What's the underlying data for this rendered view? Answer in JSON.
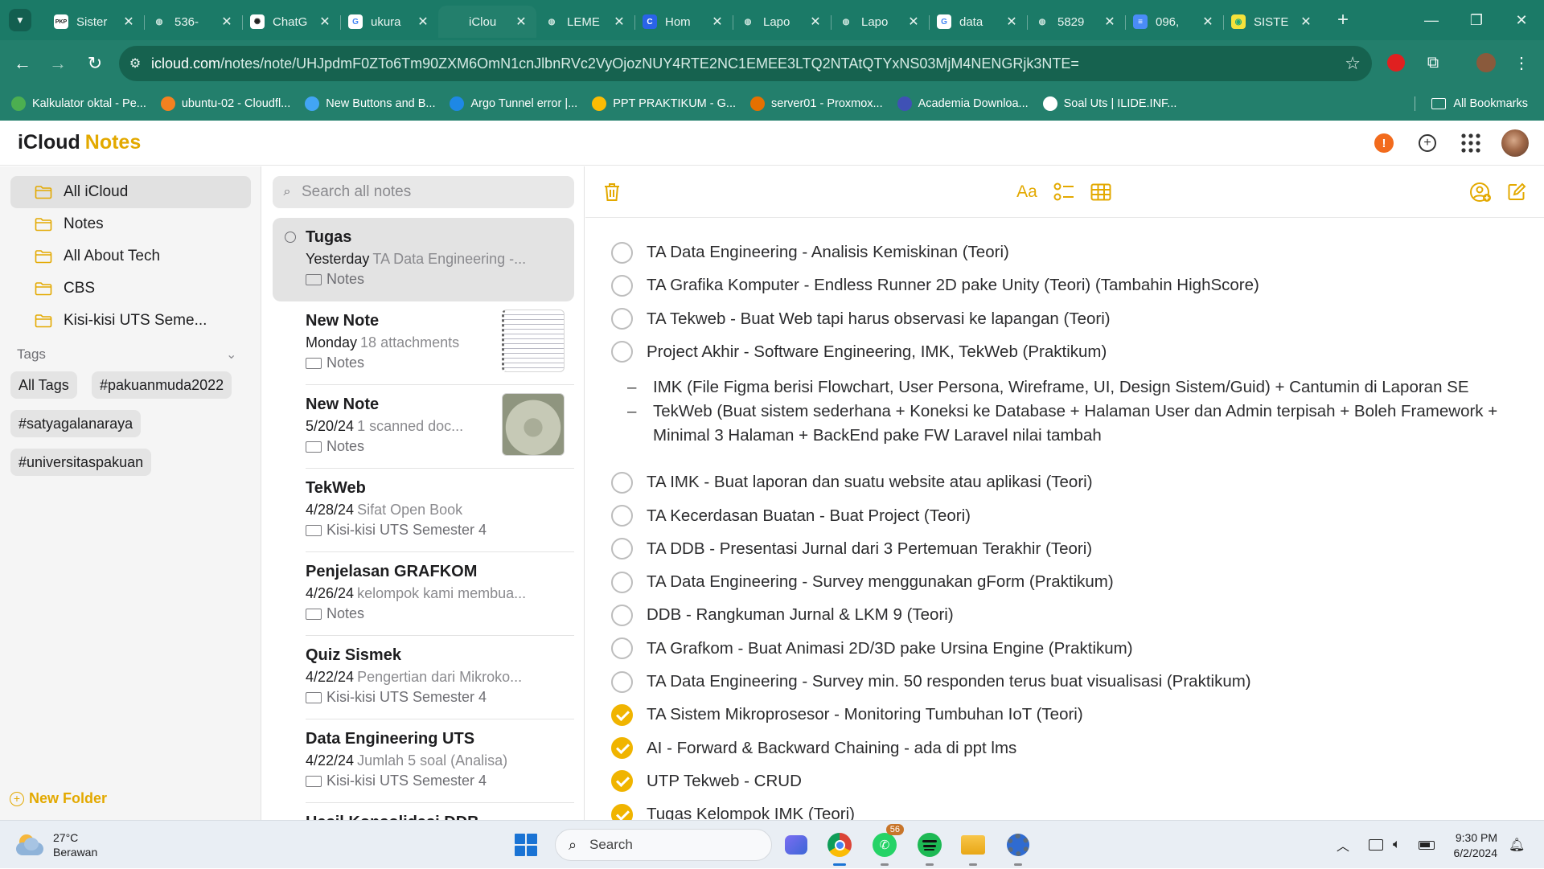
{
  "browser": {
    "tabs": [
      {
        "title": "Sister",
        "icon": "pkp-icon",
        "active": false
      },
      {
        "title": "536-",
        "icon": "globe-icon",
        "active": false
      },
      {
        "title": "ChatG",
        "icon": "openai-icon",
        "active": false
      },
      {
        "title": "ukura",
        "icon": "google-icon",
        "active": false
      },
      {
        "title": "iClou",
        "icon": "apple-icon",
        "active": true
      },
      {
        "title": "LEME",
        "icon": "globe-icon",
        "active": false
      },
      {
        "title": "Hom",
        "icon": "canva-icon",
        "active": false
      },
      {
        "title": "Lapo",
        "icon": "globe-icon",
        "active": false
      },
      {
        "title": "Lapo",
        "icon": "globe-icon",
        "active": false
      },
      {
        "title": "data",
        "icon": "google-icon",
        "active": false
      },
      {
        "title": "5829",
        "icon": "globe-icon",
        "active": false
      },
      {
        "title": "096,",
        "icon": "docs-icon",
        "active": false
      },
      {
        "title": "SISTE",
        "icon": "siste-icon",
        "active": false
      }
    ],
    "url_host": "icloud.com",
    "url_path": "/notes/note/UHJpdmF0ZTo6Tm90ZXM6OmN1cnJlbnRVc2VyOjozNUY4RTE2NC1EMEE3LTQ2NTAtQTYxNS03MjM4NENGRjk3NTE=",
    "bookmarks": [
      {
        "label": "Kalkulator oktal - Pe...",
        "icon": "gear-icon",
        "color": "#4caf50"
      },
      {
        "label": "ubuntu-02 - Cloudfl...",
        "icon": "cloudflare-icon",
        "color": "#f48120"
      },
      {
        "label": "New Buttons and B...",
        "icon": "feather-icon",
        "color": "#42a5f5"
      },
      {
        "label": "Argo Tunnel error |...",
        "icon": "argo-icon",
        "color": "#1e88e5"
      },
      {
        "label": "PPT PRAKTIKUM - G...",
        "icon": "drive-icon",
        "color": "#fbbc04"
      },
      {
        "label": "server01 - Proxmox...",
        "icon": "proxmox-icon",
        "color": "#e57000"
      },
      {
        "label": "Academia Downloa...",
        "icon": "academia-icon",
        "color": "#3f51b5"
      },
      {
        "label": "Soal Uts | ILIDE.INF...",
        "icon": "globe-icon",
        "color": "#ffffff"
      }
    ],
    "all_bookmarks_label": "All Bookmarks"
  },
  "app": {
    "brand_icloud": "iCloud",
    "brand_notes": "Notes",
    "accent": "#e3a900"
  },
  "sidebar": {
    "folders": [
      {
        "label": "All iCloud",
        "active": true
      },
      {
        "label": "Notes",
        "active": false
      },
      {
        "label": "All About Tech",
        "active": false
      },
      {
        "label": "CBS",
        "active": false
      },
      {
        "label": "Kisi-kisi UTS Seme...",
        "active": false
      }
    ],
    "tags_label": "Tags",
    "tags": [
      "All Tags",
      "#pakuanmuda2022",
      "#satyagalanaraya",
      "#universitaspakuan"
    ],
    "new_folder_label": "New Folder"
  },
  "notelist": {
    "search_placeholder": "Search all notes",
    "notes": [
      {
        "title": "Tugas",
        "date": "Yesterday",
        "snippet": "TA Data Engineering -...",
        "folder": "Notes",
        "selected": true,
        "shared": true,
        "thumb": "none"
      },
      {
        "title": "New Note",
        "date": "Monday",
        "snippet": "18 attachments",
        "folder": "Notes",
        "selected": false,
        "shared": false,
        "thumb": "handwriting"
      },
      {
        "title": "New Note",
        "date": "5/20/24",
        "snippet": "1 scanned doc...",
        "folder": "Notes",
        "selected": false,
        "shared": false,
        "thumb": "certificate"
      },
      {
        "title": "TekWeb",
        "date": "4/28/24",
        "snippet": "Sifat Open Book",
        "folder": "Kisi-kisi UTS Semester 4",
        "selected": false,
        "shared": false,
        "thumb": "none"
      },
      {
        "title": "Penjelasan GRAFKOM",
        "date": "4/26/24",
        "snippet": "kelompok kami membua...",
        "folder": "Notes",
        "selected": false,
        "shared": false,
        "thumb": "none"
      },
      {
        "title": "Quiz Sismek",
        "date": "4/22/24",
        "snippet": "Pengertian dari Mikroko...",
        "folder": "Kisi-kisi UTS Semester 4",
        "selected": false,
        "shared": false,
        "thumb": "none"
      },
      {
        "title": "Data Engineering UTS",
        "date": "4/22/24",
        "snippet": "Jumlah 5 soal (Analisa)",
        "folder": "Kisi-kisi UTS Semester 4",
        "selected": false,
        "shared": false,
        "thumb": "none"
      },
      {
        "title": "Hasil Konsolidasi DDB, ...",
        "date": "",
        "snippet": "",
        "folder": "",
        "selected": false,
        "shared": false,
        "thumb": "none"
      }
    ]
  },
  "editor": {
    "format_label": "Aa",
    "tasks_before": [
      {
        "text": "TA Data Engineering - Analisis Kemiskinan (Teori)",
        "done": false
      },
      {
        "text": "TA Grafika Komputer - Endless Runner 2D pake Unity (Teori) (Tambahin HighScore)",
        "done": false
      },
      {
        "text": "TA Tekweb - Buat Web tapi harus observasi ke lapangan (Teori)",
        "done": false
      },
      {
        "text": "Project Akhir - Software Engineering, IMK, TekWeb (Praktikum)",
        "done": false
      }
    ],
    "subitems": [
      {
        "dash": "–",
        "text": "IMK (File Figma berisi Flowchart, User Persona, Wireframe, UI, Design Sistem/Guid) + Cantumin di Laporan SE"
      },
      {
        "dash": "–",
        "text": "TekWeb (Buat sistem sederhana + Koneksi ke Database + Halaman User dan Admin terpisah + Boleh Framework + Minimal 3 Halaman + BackEnd pake FW Laravel nilai tambah"
      }
    ],
    "tasks_after": [
      {
        "text": "TA IMK - Buat laporan dan suatu website atau aplikasi (Teori)",
        "done": false
      },
      {
        "text": "TA Kecerdasan Buatan - Buat Project (Teori)",
        "done": false
      },
      {
        "text": "TA DDB - Presentasi Jurnal dari 3 Pertemuan Terakhir (Teori)",
        "done": false
      },
      {
        "text": "TA Data Engineering - Survey menggunakan gForm (Praktikum)",
        "done": false
      },
      {
        "text": "DDB - Rangkuman Jurnal & LKM 9 (Teori)",
        "done": false
      },
      {
        "text": "TA Grafkom - Buat Animasi 2D/3D pake Ursina Engine (Praktikum)",
        "done": false
      },
      {
        "text": "TA Data Engineering - Survey min. 50 responden terus buat visualisasi (Praktikum)",
        "done": false
      },
      {
        "text": "TA Sistem Mikroprosesor - Monitoring Tumbuhan IoT (Teori)",
        "done": true
      },
      {
        "text": "AI - Forward & Backward Chaining - ada di ppt lms",
        "done": true
      },
      {
        "text": "UTP Tekweb - CRUD",
        "done": true
      },
      {
        "text": "Tugas Kelompok IMK (Teori)",
        "done": true
      }
    ]
  },
  "taskbar": {
    "temperature": "27°C",
    "weather": "Berawan",
    "search_label": "Search",
    "whatsapp_badge": "56",
    "time": "9:30 PM",
    "date": "6/2/2024"
  }
}
